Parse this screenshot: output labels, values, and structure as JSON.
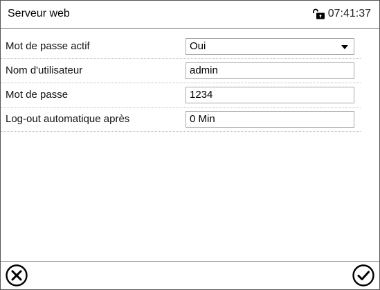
{
  "header": {
    "title": "Serveur web",
    "time": "07:41:37",
    "status_icon": "unlocked-padlock-icon"
  },
  "settings": [
    {
      "label": "Mot de passe actif",
      "value": "Oui",
      "type": "select"
    },
    {
      "label": "Nom d'utilisateur",
      "value": "admin",
      "type": "text"
    },
    {
      "label": "Mot de passe",
      "value": "1234",
      "type": "text"
    },
    {
      "label": "Log-out automatique après",
      "value": "0 Min",
      "type": "text"
    }
  ],
  "footer": {
    "cancel_icon": "close-circle-icon",
    "confirm_icon": "check-circle-icon"
  }
}
